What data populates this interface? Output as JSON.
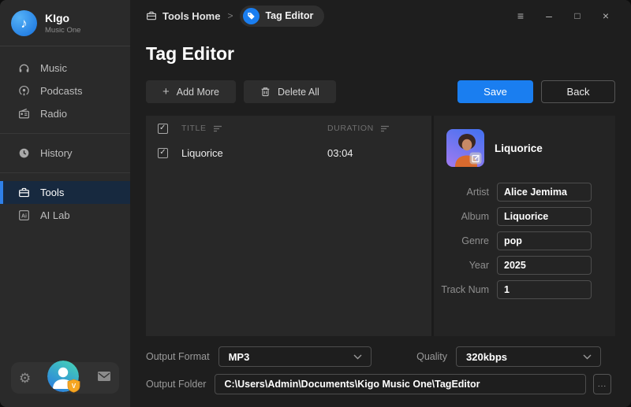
{
  "app": {
    "name": "KIgo",
    "subtitle": "Music One"
  },
  "icons": {
    "logo": "♪",
    "gear": "⚙",
    "menu": "≡",
    "minimize": "–",
    "maximize": "□",
    "close": "×",
    "plus": "+",
    "check": "✓",
    "dots": "...",
    "breadcrumb_sep": ">"
  },
  "colors": {
    "accent": "#1a7ef0",
    "sidebar_active_bar": "#2f80e8",
    "badge": "#f5a623",
    "avatar_gradient": [
      "#45d0b8",
      "#2a7de0"
    ],
    "art_gradient": [
      "#4a72f0",
      "#9b7af0"
    ]
  },
  "sidebar": {
    "items": [
      {
        "label": "Music"
      },
      {
        "label": "Podcasts"
      },
      {
        "label": "Radio"
      },
      {
        "label": "History"
      },
      {
        "label": "Tools",
        "active": true
      },
      {
        "label": "AI Lab"
      }
    ],
    "ai_icon_text": "Ai"
  },
  "breadcrumb": {
    "home": "Tools Home",
    "current": "Tag Editor"
  },
  "page": {
    "title": "Tag Editor"
  },
  "toolbar": {
    "add_more_label": "Add More",
    "delete_all_label": "Delete All",
    "save_label": "Save",
    "back_label": "Back"
  },
  "table": {
    "columns": [
      "TITLE",
      "DURATION"
    ],
    "rows": [
      {
        "title": "Liquorice",
        "duration": "03:04",
        "checked": true
      }
    ]
  },
  "detail": {
    "track_title": "Liquorice",
    "fields": [
      {
        "label": "Artist",
        "value": "Alice Jemima"
      },
      {
        "label": "Album",
        "value": "Liquorice"
      },
      {
        "label": "Genre",
        "value": "pop"
      },
      {
        "label": "Year",
        "value": "2025"
      },
      {
        "label": "Track Num",
        "value": "1"
      }
    ]
  },
  "output": {
    "format_label": "Output Format",
    "format_value": "MP3",
    "quality_label": "Quality",
    "quality_value": "320kbps",
    "folder_label": "Output Folder",
    "folder_value": "C:\\Users\\Admin\\Documents\\Kigo Music One\\TagEditor",
    "browse_label": "..."
  }
}
